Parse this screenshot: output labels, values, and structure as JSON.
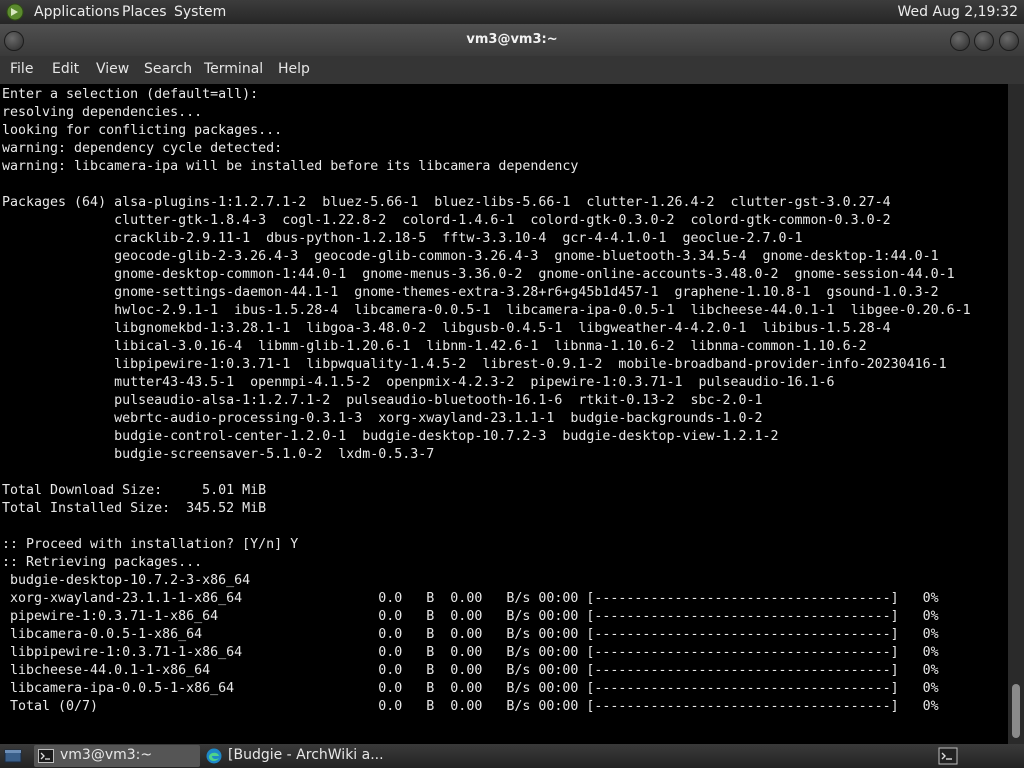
{
  "top_panel": {
    "menus": [
      "Applications",
      "Places",
      "System"
    ],
    "clock": "Wed Aug  2,19:32"
  },
  "window": {
    "title": "vm3@vm3:~",
    "menus": [
      "File",
      "Edit",
      "View",
      "Search",
      "Terminal",
      "Help"
    ]
  },
  "terminal": {
    "lines": [
      "Enter a selection (default=all):",
      "resolving dependencies...",
      "looking for conflicting packages...",
      "warning: dependency cycle detected:",
      "warning: libcamera-ipa will be installed before its libcamera dependency",
      "",
      "Packages (64) alsa-plugins-1:1.2.7.1-2  bluez-5.66-1  bluez-libs-5.66-1  clutter-1.26.4-2  clutter-gst-3.0.27-4",
      "              clutter-gtk-1.8.4-3  cogl-1.22.8-2  colord-1.4.6-1  colord-gtk-0.3.0-2  colord-gtk-common-0.3.0-2",
      "              cracklib-2.9.11-1  dbus-python-1.2.18-5  fftw-3.3.10-4  gcr-4-4.1.0-1  geoclue-2.7.0-1",
      "              geocode-glib-2-3.26.4-3  geocode-glib-common-3.26.4-3  gnome-bluetooth-3.34.5-4  gnome-desktop-1:44.0-1",
      "              gnome-desktop-common-1:44.0-1  gnome-menus-3.36.0-2  gnome-online-accounts-3.48.0-2  gnome-session-44.0-1",
      "              gnome-settings-daemon-44.1-1  gnome-themes-extra-3.28+r6+g45b1d457-1  graphene-1.10.8-1  gsound-1.0.3-2",
      "              hwloc-2.9.1-1  ibus-1.5.28-4  libcamera-0.0.5-1  libcamera-ipa-0.0.5-1  libcheese-44.0.1-1  libgee-0.20.6-1",
      "              libgnomekbd-1:3.28.1-1  libgoa-3.48.0-2  libgusb-0.4.5-1  libgweather-4-4.2.0-1  libibus-1.5.28-4",
      "              libical-3.0.16-4  libmm-glib-1.20.6-1  libnm-1.42.6-1  libnma-1.10.6-2  libnma-common-1.10.6-2",
      "              libpipewire-1:0.3.71-1  libpwquality-1.4.5-2  librest-0.9.1-2  mobile-broadband-provider-info-20230416-1",
      "              mutter43-43.5-1  openmpi-4.1.5-2  openpmix-4.2.3-2  pipewire-1:0.3.71-1  pulseaudio-16.1-6",
      "              pulseaudio-alsa-1:1.2.7.1-2  pulseaudio-bluetooth-16.1-6  rtkit-0.13-2  sbc-2.0-1",
      "              webrtc-audio-processing-0.3.1-3  xorg-xwayland-23.1.1-1  budgie-backgrounds-1.0-2",
      "              budgie-control-center-1.2.0-1  budgie-desktop-10.7.2-3  budgie-desktop-view-1.2.1-2",
      "              budgie-screensaver-5.1.0-2  lxdm-0.5.3-7",
      "",
      "Total Download Size:     5.01 MiB",
      "Total Installed Size:  345.52 MiB",
      "",
      ":: Proceed with installation? [Y/n] Y",
      ":: Retrieving packages...",
      " budgie-desktop-10.7.2-3-x86_64",
      " xorg-xwayland-23.1.1-1-x86_64                 0.0   B  0.00   B/s 00:00 [-------------------------------------]   0%",
      " pipewire-1:0.3.71-1-x86_64                    0.0   B  0.00   B/s 00:00 [-------------------------------------]   0%",
      " libcamera-0.0.5-1-x86_64                      0.0   B  0.00   B/s 00:00 [-------------------------------------]   0%",
      " libpipewire-1:0.3.71-1-x86_64                 0.0   B  0.00   B/s 00:00 [-------------------------------------]   0%",
      " libcheese-44.0.1-1-x86_64                     0.0   B  0.00   B/s 00:00 [-------------------------------------]   0%",
      " libcamera-ipa-0.0.5-1-x86_64                  0.0   B  0.00   B/s 00:00 [-------------------------------------]   0%",
      " Total (0/7)                                   0.0   B  0.00   B/s 00:00 [-------------------------------------]   0%"
    ]
  },
  "taskbar": {
    "tasks": [
      {
        "label": "vm3@vm3:~",
        "icon": "terminal-icon",
        "active": true
      },
      {
        "label": "[Budgie - ArchWiki a...",
        "icon": "edge-browser-icon",
        "active": false
      }
    ],
    "tray_icon": "terminal-icon"
  },
  "colors": {
    "terminal_bg": "#000000",
    "terminal_fg": "#e8e8e8",
    "panel_bg": "#2b2b2b"
  }
}
